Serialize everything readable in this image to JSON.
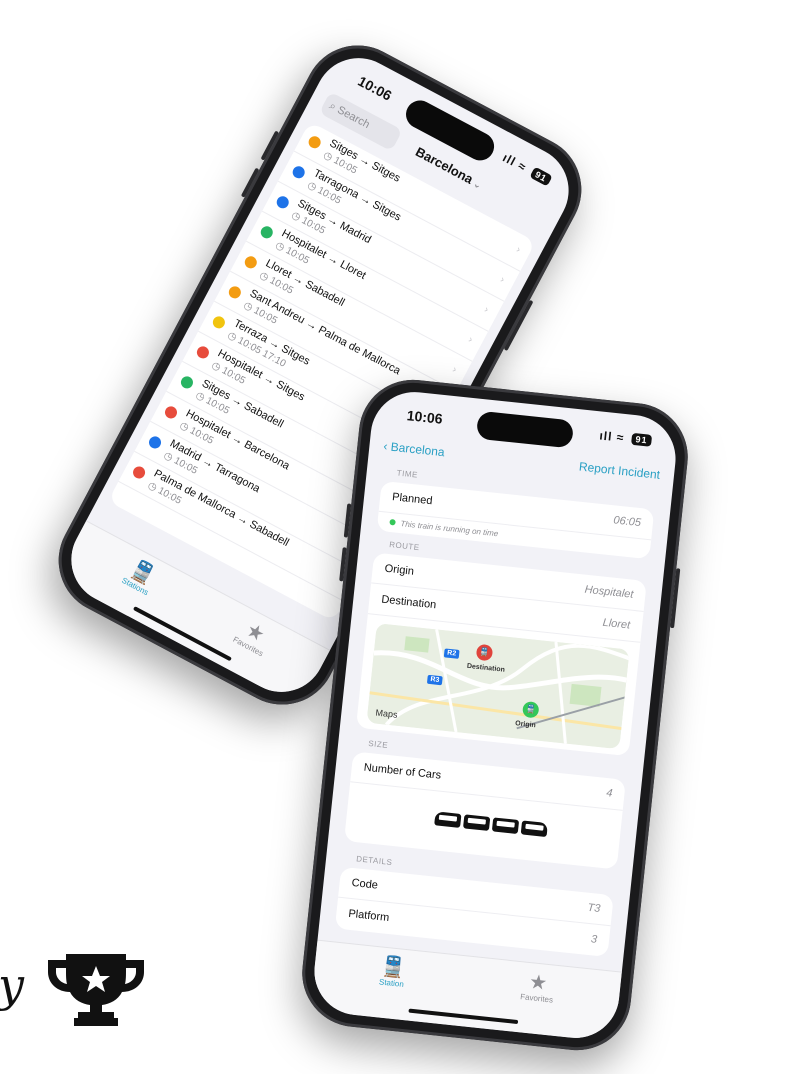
{
  "phone1": {
    "status": {
      "time": "10:06",
      "signal": "ıll",
      "wifi": "≈",
      "battery": "91"
    },
    "search_placeholder": "Search",
    "title": "Barcelona",
    "rows": [
      {
        "from": "Sitges",
        "to": "Sitges",
        "time": "10:05",
        "color": "#f39c12"
      },
      {
        "from": "Tarragona",
        "to": "Sitges",
        "time": "10:05",
        "color": "#1e73e8"
      },
      {
        "from": "Sitges",
        "to": "Madrid",
        "time": "10:05",
        "color": "#1e73e8"
      },
      {
        "from": "Hospitalet",
        "to": "Lloret",
        "time": "10:05",
        "color": "#28b463"
      },
      {
        "from": "Lloret",
        "to": "Sabadell",
        "time": "10:05",
        "color": "#f39c12"
      },
      {
        "from": "Sant Andreu",
        "to": "Palma de Mallorca",
        "time": "10:05",
        "color": "#f39c12"
      },
      {
        "from": "Terraza",
        "to": "Sitges",
        "time": "10:05 17:10",
        "color": "#f1c40f"
      },
      {
        "from": "Hospitalet",
        "to": "Sitges",
        "time": "10:05",
        "color": "#e74c3c"
      },
      {
        "from": "Sitges",
        "to": "Sabadell",
        "time": "10:05",
        "color": "#28b463"
      },
      {
        "from": "Hospitalet",
        "to": "Barcelona",
        "time": "10:05",
        "color": "#e74c3c"
      },
      {
        "from": "Madrid",
        "to": "Tarragona",
        "time": "10:05",
        "color": "#1e73e8"
      },
      {
        "from": "Palma de Mallorca",
        "to": "Sabadell",
        "time": "10:05",
        "color": "#e74c3c"
      }
    ],
    "tabs": {
      "stations": "Stations",
      "favorites": "Favorites"
    }
  },
  "phone2": {
    "status": {
      "time": "10:06",
      "signal": "ıll",
      "wifi": "≈",
      "battery": "91"
    },
    "back_label": "Barcelona",
    "report_label": "Report Incident",
    "time_section": "TIME",
    "planned_label": "Planned",
    "planned_value": "06:05",
    "ontime_text": "This train is running on time",
    "route_section": "ROUTE",
    "origin_label": "Origin",
    "origin_value": "Hospitalet",
    "destination_label": "Destination",
    "destination_value": "Lloret",
    "map": {
      "destination_pin": "Destination",
      "origin_pin": "Origin",
      "maps_label": "Maps",
      "badge_1": "R2",
      "badge_2": "R3"
    },
    "size_section": "SIZE",
    "cars_label": "Number of Cars",
    "cars_value": "4",
    "details_section": "DETAILS",
    "code_label": "Code",
    "code_value": "T3",
    "platform_label": "Platform",
    "platform_value": "3",
    "tabs": {
      "stations": "Station",
      "favorites": "Favorites"
    }
  },
  "colors": {
    "accent": "#2aa0c4",
    "ontime": "#34c759"
  }
}
